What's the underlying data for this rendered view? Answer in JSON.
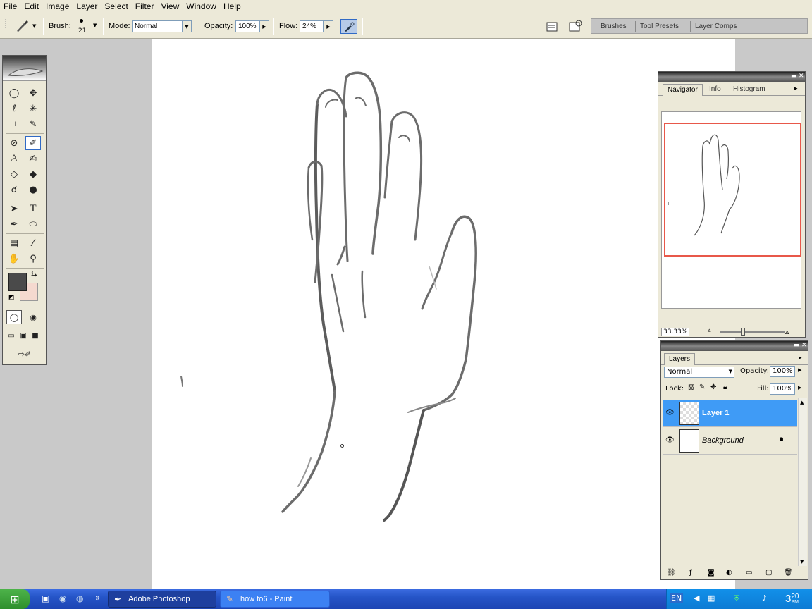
{
  "menu": [
    "File",
    "Edit",
    "Image",
    "Layer",
    "Select",
    "Filter",
    "View",
    "Window",
    "Help"
  ],
  "options": {
    "brush_label": "Brush:",
    "brush_size": "21",
    "mode_label": "Mode:",
    "mode_value": "Normal",
    "opacity_label": "Opacity:",
    "opacity_value": "100%",
    "flow_label": "Flow:",
    "flow_value": "24%"
  },
  "palette_well": [
    "Brushes",
    "Tool Presets",
    "Layer Comps"
  ],
  "navigator": {
    "tabs": [
      "Navigator",
      "Info",
      "Histogram"
    ],
    "zoom": "33.33%"
  },
  "layers": {
    "title": "Layers",
    "blend_mode": "Normal",
    "opacity_label": "Opacity:",
    "opacity_value": "100%",
    "lock_label": "Lock:",
    "fill_label": "Fill:",
    "fill_value": "100%",
    "items": [
      {
        "name": "Layer 1",
        "selected": true
      },
      {
        "name": "Background",
        "selected": false
      }
    ]
  },
  "taskbar": {
    "tasks": [
      "Adobe Photoshop",
      "how to6 - Paint"
    ],
    "lang": "EN",
    "clock_hour": "3",
    "clock_min": "20",
    "clock_ampm": "PM"
  },
  "colors": {
    "foreground": "#4a4a4a",
    "background": "#f5d9cf",
    "selection": "#3f9bf6",
    "navigator_frame": "#e8584a"
  }
}
